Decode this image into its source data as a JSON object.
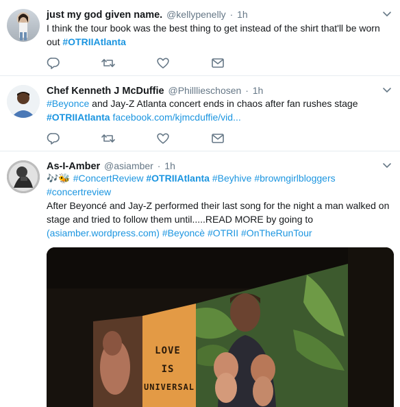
{
  "tweets": [
    {
      "name": "just my god given name.",
      "handle": "@kellypenelly",
      "separator": "·",
      "time": "1h",
      "lines": [
        {
          "text": "I think the tour book was the best thing to get instead of the shirt that'll be worn"
        },
        {
          "text": "out ",
          "hashtag": "#OTRIIAtlanta"
        }
      ]
    },
    {
      "name": "Chef Kenneth J McDuffie",
      "handle": "@Philllieschosen",
      "separator": "·",
      "time": "1h",
      "line1_hashtag": "#Beyonce",
      "line1_text": " and Jay-Z Atlanta concert ends in chaos after fan rushes stage",
      "line2_hashtag": "#OTRIIAtlanta",
      "line2_link": "facebook.com/kjmcduffie/vid..."
    },
    {
      "name": "As-I-Amber",
      "handle": "@asiamber",
      "separator": "·",
      "time": "1h",
      "emoji": "🎶🐝",
      "line1_tags": [
        "#ConcertReview",
        "#OTRIIAtlanta",
        "#Beyhive",
        "#browngirlbloggers"
      ],
      "line2_tag": "#concertreview",
      "line3": "After Beyoncé and Jay-Z performed their last song for the night a man walked on",
      "line4": "stage and tried to follow them until.....READ MORE by going to",
      "line5_link": "(asiamber.wordpress.com)",
      "line5_tags": [
        "#Beyoncè",
        "#OTRII",
        "#OnTheRunTour"
      ],
      "poster_lines": [
        "LOVE",
        "IS",
        "UNIVERSAL"
      ]
    }
  ],
  "icons": {
    "reply": "reply-icon",
    "retweet": "retweet-icon",
    "like": "heart-icon",
    "dm": "direct-message-icon",
    "caret": "chevron-down-icon"
  },
  "colors": {
    "link": "#1b95e0",
    "muted": "#657786",
    "text": "#14171a",
    "divider": "#e6ecf0"
  }
}
